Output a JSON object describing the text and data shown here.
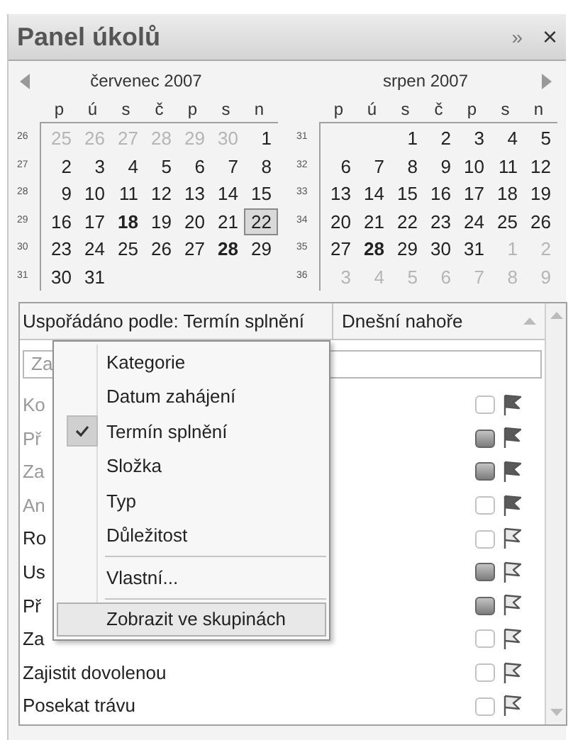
{
  "panel": {
    "title": "Panel úkolů",
    "expand_glyph": "»",
    "close_glyph": "×"
  },
  "calendar": {
    "months": [
      {
        "title": "červenec 2007",
        "has_prev": true,
        "has_next": false,
        "weekdays": [
          "p",
          "ú",
          "s",
          "č",
          "p",
          "s",
          "n"
        ],
        "weeks": [
          {
            "number": "26",
            "days": [
              {
                "d": "25",
                "other": true,
                "bold": false,
                "today": false
              },
              {
                "d": "26",
                "other": true,
                "bold": false,
                "today": false
              },
              {
                "d": "27",
                "other": true,
                "bold": false,
                "today": false
              },
              {
                "d": "28",
                "other": true,
                "bold": false,
                "today": false
              },
              {
                "d": "29",
                "other": true,
                "bold": false,
                "today": false
              },
              {
                "d": "30",
                "other": true,
                "bold": false,
                "today": false
              },
              {
                "d": "1",
                "other": false,
                "bold": false,
                "today": false
              }
            ]
          },
          {
            "number": "27",
            "days": [
              {
                "d": "2",
                "other": false,
                "bold": false,
                "today": false
              },
              {
                "d": "3",
                "other": false,
                "bold": false,
                "today": false
              },
              {
                "d": "4",
                "other": false,
                "bold": false,
                "today": false
              },
              {
                "d": "5",
                "other": false,
                "bold": false,
                "today": false
              },
              {
                "d": "6",
                "other": false,
                "bold": false,
                "today": false
              },
              {
                "d": "7",
                "other": false,
                "bold": false,
                "today": false
              },
              {
                "d": "8",
                "other": false,
                "bold": false,
                "today": false
              }
            ]
          },
          {
            "number": "28",
            "days": [
              {
                "d": "9",
                "other": false,
                "bold": false,
                "today": false
              },
              {
                "d": "10",
                "other": false,
                "bold": false,
                "today": false
              },
              {
                "d": "11",
                "other": false,
                "bold": false,
                "today": false
              },
              {
                "d": "12",
                "other": false,
                "bold": false,
                "today": false
              },
              {
                "d": "13",
                "other": false,
                "bold": false,
                "today": false
              },
              {
                "d": "14",
                "other": false,
                "bold": false,
                "today": false
              },
              {
                "d": "15",
                "other": false,
                "bold": false,
                "today": false
              }
            ]
          },
          {
            "number": "29",
            "days": [
              {
                "d": "16",
                "other": false,
                "bold": false,
                "today": false
              },
              {
                "d": "17",
                "other": false,
                "bold": false,
                "today": false
              },
              {
                "d": "18",
                "other": false,
                "bold": true,
                "today": false
              },
              {
                "d": "19",
                "other": false,
                "bold": false,
                "today": false
              },
              {
                "d": "20",
                "other": false,
                "bold": false,
                "today": false
              },
              {
                "d": "21",
                "other": false,
                "bold": false,
                "today": false
              },
              {
                "d": "22",
                "other": false,
                "bold": false,
                "today": true
              }
            ]
          },
          {
            "number": "30",
            "days": [
              {
                "d": "23",
                "other": false,
                "bold": false,
                "today": false
              },
              {
                "d": "24",
                "other": false,
                "bold": false,
                "today": false
              },
              {
                "d": "25",
                "other": false,
                "bold": false,
                "today": false
              },
              {
                "d": "26",
                "other": false,
                "bold": false,
                "today": false
              },
              {
                "d": "27",
                "other": false,
                "bold": false,
                "today": false
              },
              {
                "d": "28",
                "other": false,
                "bold": true,
                "today": false
              },
              {
                "d": "29",
                "other": false,
                "bold": false,
                "today": false
              }
            ]
          },
          {
            "number": "31",
            "days": [
              {
                "d": "30",
                "other": false,
                "bold": false,
                "today": false
              },
              {
                "d": "31",
                "other": false,
                "bold": false,
                "today": false
              }
            ]
          }
        ]
      },
      {
        "title": "srpen 2007",
        "has_prev": false,
        "has_next": true,
        "weekdays": [
          "p",
          "ú",
          "s",
          "č",
          "p",
          "s",
          "n"
        ],
        "weeks": [
          {
            "number": "31",
            "days": [
              {
                "kind": "blank"
              },
              {
                "kind": "blank"
              },
              {
                "d": "1",
                "other": false,
                "bold": false,
                "today": false
              },
              {
                "d": "2",
                "other": false,
                "bold": false,
                "today": false
              },
              {
                "d": "3",
                "other": false,
                "bold": false,
                "today": false
              },
              {
                "d": "4",
                "other": false,
                "bold": false,
                "today": false
              },
              {
                "d": "5",
                "other": false,
                "bold": false,
                "today": false
              }
            ]
          },
          {
            "number": "32",
            "days": [
              {
                "d": "6",
                "other": false,
                "bold": false,
                "today": false
              },
              {
                "d": "7",
                "other": false,
                "bold": false,
                "today": false
              },
              {
                "d": "8",
                "other": false,
                "bold": false,
                "today": false
              },
              {
                "d": "9",
                "other": false,
                "bold": false,
                "today": false
              },
              {
                "d": "10",
                "other": false,
                "bold": false,
                "today": false
              },
              {
                "d": "11",
                "other": false,
                "bold": false,
                "today": false
              },
              {
                "d": "12",
                "other": false,
                "bold": false,
                "today": false
              }
            ]
          },
          {
            "number": "33",
            "days": [
              {
                "d": "13",
                "other": false,
                "bold": false,
                "today": false
              },
              {
                "d": "14",
                "other": false,
                "bold": false,
                "today": false
              },
              {
                "d": "15",
                "other": false,
                "bold": false,
                "today": false
              },
              {
                "d": "16",
                "other": false,
                "bold": false,
                "today": false
              },
              {
                "d": "17",
                "other": false,
                "bold": false,
                "today": false
              },
              {
                "d": "18",
                "other": false,
                "bold": false,
                "today": false
              },
              {
                "d": "19",
                "other": false,
                "bold": false,
                "today": false
              }
            ]
          },
          {
            "number": "34",
            "days": [
              {
                "d": "20",
                "other": false,
                "bold": false,
                "today": false
              },
              {
                "d": "21",
                "other": false,
                "bold": false,
                "today": false
              },
              {
                "d": "22",
                "other": false,
                "bold": false,
                "today": false
              },
              {
                "d": "23",
                "other": false,
                "bold": false,
                "today": false
              },
              {
                "d": "24",
                "other": false,
                "bold": false,
                "today": false
              },
              {
                "d": "25",
                "other": false,
                "bold": false,
                "today": false
              },
              {
                "d": "26",
                "other": false,
                "bold": false,
                "today": false
              }
            ]
          },
          {
            "number": "35",
            "days": [
              {
                "d": "27",
                "other": false,
                "bold": false,
                "today": false
              },
              {
                "d": "28",
                "other": false,
                "bold": true,
                "today": false
              },
              {
                "d": "29",
                "other": false,
                "bold": false,
                "today": false
              },
              {
                "d": "30",
                "other": false,
                "bold": false,
                "today": false
              },
              {
                "d": "31",
                "other": false,
                "bold": false,
                "today": false
              },
              {
                "d": "1",
                "other": true,
                "bold": false,
                "today": false
              },
              {
                "d": "2",
                "other": true,
                "bold": false,
                "today": false
              }
            ]
          },
          {
            "number": "36",
            "days": [
              {
                "d": "3",
                "other": true,
                "bold": false,
                "today": false
              },
              {
                "d": "4",
                "other": true,
                "bold": false,
                "today": false
              },
              {
                "d": "5",
                "other": true,
                "bold": false,
                "today": false
              },
              {
                "d": "6",
                "other": true,
                "bold": false,
                "today": false
              },
              {
                "d": "7",
                "other": true,
                "bold": false,
                "today": false
              },
              {
                "d": "8",
                "other": true,
                "bold": false,
                "today": false
              },
              {
                "d": "9",
                "other": true,
                "bold": false,
                "today": false
              }
            ]
          }
        ]
      }
    ]
  },
  "task_list": {
    "arranged_by": "Uspořádáno podle: Termín splnění",
    "sort_order": "Dnešní nahoře",
    "new_task_field": {
      "placeholder": "Za"
    },
    "tasks": [
      {
        "text": "Ko",
        "dimmed": true,
        "category": false,
        "dark_flag": true
      },
      {
        "text": "Př",
        "dimmed": true,
        "category": true,
        "dark_flag": true
      },
      {
        "text": "Za",
        "dimmed": true,
        "category": true,
        "dark_flag": true
      },
      {
        "text": "An",
        "dimmed": true,
        "category": false,
        "dark_flag": true
      },
      {
        "text": "Ro",
        "dimmed": false,
        "category": false,
        "dark_flag": false
      },
      {
        "text": "Us",
        "dimmed": false,
        "category": true,
        "dark_flag": false
      },
      {
        "text": "Př",
        "dimmed": false,
        "category": true,
        "dark_flag": false
      },
      {
        "text": "Za",
        "dimmed": false,
        "category": false,
        "dark_flag": false
      },
      {
        "text": "Zajistit dovolenou",
        "dimmed": false,
        "category": false,
        "dark_flag": false
      },
      {
        "text": "Posekat trávu",
        "dimmed": false,
        "category": false,
        "dark_flag": false
      }
    ]
  },
  "menu": {
    "items": [
      {
        "label": "Kategorie",
        "checked": false,
        "highlighted": false,
        "separator_before": false
      },
      {
        "label": "Datum zahájení",
        "checked": false,
        "highlighted": false,
        "separator_before": false
      },
      {
        "label": "Termín splnění",
        "checked": true,
        "highlighted": false,
        "separator_before": false
      },
      {
        "label": "Složka",
        "checked": false,
        "highlighted": false,
        "separator_before": false
      },
      {
        "label": "Typ",
        "checked": false,
        "highlighted": false,
        "separator_before": false
      },
      {
        "label": "Důležitost",
        "checked": false,
        "highlighted": false,
        "separator_before": false
      },
      {
        "label": "Vlastní...",
        "checked": false,
        "highlighted": false,
        "separator_before": true
      },
      {
        "label": "Zobrazit ve skupinách",
        "checked": false,
        "highlighted": true,
        "separator_before": true
      }
    ]
  }
}
